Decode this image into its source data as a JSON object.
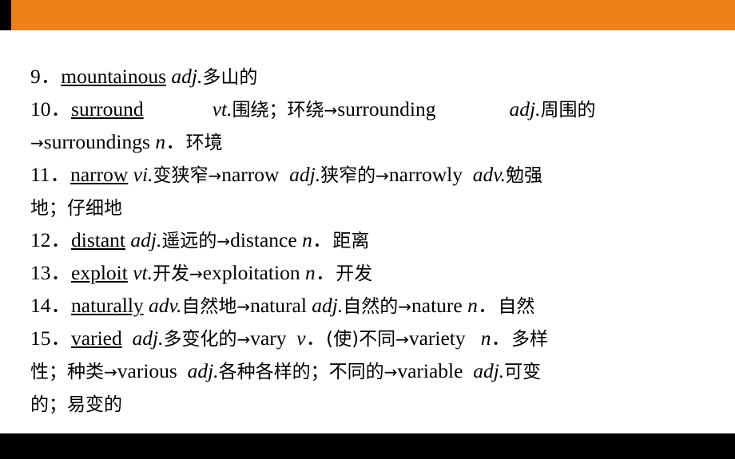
{
  "slide": {
    "top_bar_color": "#ee8018",
    "accent_black": "#000000",
    "background": "#ffffff",
    "arrow_glyph": "→",
    "entries": [
      {
        "number": "9．",
        "headword": "mountainous",
        "pos": "adj.",
        "meaning": "多山的",
        "full_text": "9．mountainous adj.多山的"
      },
      {
        "number": "10．",
        "headword": "surround",
        "pos": "vt.",
        "meaning": "围绕；环绕",
        "derivations": "→surrounding adj.周围的→surroundings n．环境",
        "full_text": "10．surround vt.围绕；环绕→surrounding adj.周围的→surroundings n．环境"
      },
      {
        "number": "11．",
        "headword": "narrow",
        "pos": "vi.",
        "meaning": "变狭窄",
        "derivations": "→narrow adj.狭窄的→narrowly adv.勉强地；仔细地",
        "full_text": "11．narrow vi.变狭窄→narrow adj.狭窄的→narrowly adv.勉强地；仔细地"
      },
      {
        "number": "12．",
        "headword": "distant",
        "pos": "adj.",
        "meaning": "遥远的",
        "derivations": "→distance n．距离",
        "full_text": "12．distant adj.遥远的→distance n．距离"
      },
      {
        "number": "13．",
        "headword": "exploit",
        "pos": "vt.",
        "meaning": "开发",
        "derivations": "→exploitation n．开发",
        "full_text": "13．exploit vt.开发→exploitation n．开发"
      },
      {
        "number": "14．",
        "headword": "naturally",
        "pos": "adv.",
        "meaning": "自然地",
        "derivations": "→natural adj.自然的→nature n．自然",
        "full_text": "14．naturally adv.自然地→natural adj.自然的→nature n．自然"
      },
      {
        "number": "15．",
        "headword": "varied",
        "pos": "adj.",
        "meaning": "多变化的",
        "derivations": "→vary v．(使)不同→variety n．多样性；种类→various adj.各种各样的；不同的→variable adj.可变的；易变的",
        "full_text": "15．varied adj.多变化的→vary v．(使)不同→variety n．多样性；种类→various adj.各种各样的；不同的→variable adj.可变的；易变的"
      }
    ],
    "lines": [
      {
        "id": "line-9",
        "segments": [
          {
            "type": "num",
            "text": "9．"
          },
          {
            "type": "hw",
            "text": "mountainous"
          },
          {
            "type": "sp",
            "text": " "
          },
          {
            "type": "pos",
            "text": "adj."
          },
          {
            "type": "cn",
            "text": "多山的"
          }
        ]
      },
      {
        "id": "line-10a",
        "segments": [
          {
            "type": "num",
            "text": "10．"
          },
          {
            "type": "hw",
            "text": "surround"
          },
          {
            "type": "gap-wide",
            "text": ""
          },
          {
            "type": "pos",
            "text": "vt."
          },
          {
            "type": "cn",
            "text": "围绕；环绕"
          },
          {
            "type": "arrow",
            "text": "→"
          },
          {
            "type": "plain",
            "text": "surrounding"
          },
          {
            "type": "gap-wide2",
            "text": ""
          },
          {
            "type": "pos",
            "text": "adj."
          },
          {
            "type": "cn",
            "text": "周围的"
          }
        ]
      },
      {
        "id": "line-10b",
        "segments": [
          {
            "type": "arrow",
            "text": "→"
          },
          {
            "type": "plain",
            "text": "surroundings "
          },
          {
            "type": "pos",
            "text": "n"
          },
          {
            "type": "plain",
            "text": "．"
          },
          {
            "type": "cn",
            "text": "环境"
          }
        ]
      },
      {
        "id": "line-11a",
        "segments": [
          {
            "type": "num",
            "text": "11．"
          },
          {
            "type": "hw",
            "text": "narrow"
          },
          {
            "type": "sp",
            "text": " "
          },
          {
            "type": "pos",
            "text": "vi."
          },
          {
            "type": "cn",
            "text": "变狭窄"
          },
          {
            "type": "arrow",
            "text": "→"
          },
          {
            "type": "plain",
            "text": "narrow"
          },
          {
            "type": "sp",
            "text": "  "
          },
          {
            "type": "pos",
            "text": "adj."
          },
          {
            "type": "cn",
            "text": "狭窄的"
          },
          {
            "type": "arrow",
            "text": "→"
          },
          {
            "type": "plain",
            "text": "narrowly"
          },
          {
            "type": "sp",
            "text": "  "
          },
          {
            "type": "pos",
            "text": "adv."
          },
          {
            "type": "cn",
            "text": "勉强"
          }
        ]
      },
      {
        "id": "line-11b",
        "segments": [
          {
            "type": "cn",
            "text": "地；仔细地"
          }
        ]
      },
      {
        "id": "line-12",
        "segments": [
          {
            "type": "num",
            "text": "12．"
          },
          {
            "type": "hw",
            "text": "distant"
          },
          {
            "type": "sp",
            "text": " "
          },
          {
            "type": "pos",
            "text": "adj."
          },
          {
            "type": "cn",
            "text": "遥远的"
          },
          {
            "type": "arrow",
            "text": "→"
          },
          {
            "type": "plain",
            "text": "distance "
          },
          {
            "type": "pos",
            "text": "n"
          },
          {
            "type": "plain",
            "text": "．"
          },
          {
            "type": "cn",
            "text": "距离"
          }
        ]
      },
      {
        "id": "line-13",
        "segments": [
          {
            "type": "num",
            "text": "13．"
          },
          {
            "type": "hw",
            "text": "exploit"
          },
          {
            "type": "sp",
            "text": " "
          },
          {
            "type": "pos",
            "text": "vt."
          },
          {
            "type": "cn",
            "text": "开发"
          },
          {
            "type": "arrow",
            "text": "→"
          },
          {
            "type": "plain",
            "text": "exploitation "
          },
          {
            "type": "pos",
            "text": "n"
          },
          {
            "type": "plain",
            "text": "．"
          },
          {
            "type": "cn",
            "text": "开发"
          }
        ]
      },
      {
        "id": "line-14",
        "segments": [
          {
            "type": "num",
            "text": "14．"
          },
          {
            "type": "hw",
            "text": "naturally"
          },
          {
            "type": "sp",
            "text": " "
          },
          {
            "type": "pos",
            "text": "adv."
          },
          {
            "type": "cn",
            "text": "自然地"
          },
          {
            "type": "arrow",
            "text": "→"
          },
          {
            "type": "plain",
            "text": "natural "
          },
          {
            "type": "pos",
            "text": "adj."
          },
          {
            "type": "cn",
            "text": "自然的"
          },
          {
            "type": "arrow",
            "text": "→"
          },
          {
            "type": "plain",
            "text": "nature "
          },
          {
            "type": "pos",
            "text": "n"
          },
          {
            "type": "plain",
            "text": "．"
          },
          {
            "type": "cn",
            "text": "自然"
          }
        ]
      },
      {
        "id": "line-15a",
        "segments": [
          {
            "type": "num",
            "text": "15．"
          },
          {
            "type": "hw",
            "text": "varied"
          },
          {
            "type": "sp",
            "text": "  "
          },
          {
            "type": "pos",
            "text": "adj."
          },
          {
            "type": "cn",
            "text": "多变化的"
          },
          {
            "type": "arrow",
            "text": "→"
          },
          {
            "type": "plain",
            "text": "vary"
          },
          {
            "type": "sp",
            "text": "  "
          },
          {
            "type": "pos",
            "text": "v"
          },
          {
            "type": "plain",
            "text": "．"
          },
          {
            "type": "cn",
            "text": "(使)不同"
          },
          {
            "type": "arrow",
            "text": "→"
          },
          {
            "type": "plain",
            "text": "variety"
          },
          {
            "type": "sp",
            "text": "   "
          },
          {
            "type": "pos",
            "text": "n"
          },
          {
            "type": "plain",
            "text": "．"
          },
          {
            "type": "cn",
            "text": "多样"
          }
        ]
      },
      {
        "id": "line-15b",
        "segments": [
          {
            "type": "cn",
            "text": "性；种类"
          },
          {
            "type": "arrow",
            "text": "→"
          },
          {
            "type": "plain",
            "text": "various"
          },
          {
            "type": "sp",
            "text": "  "
          },
          {
            "type": "pos",
            "text": "adj."
          },
          {
            "type": "cn",
            "text": "各种各样的；不同的"
          },
          {
            "type": "arrow",
            "text": "→"
          },
          {
            "type": "plain",
            "text": "variable"
          },
          {
            "type": "sp",
            "text": "  "
          },
          {
            "type": "pos",
            "text": "adj."
          },
          {
            "type": "cn",
            "text": "可变"
          }
        ]
      },
      {
        "id": "line-15c",
        "segments": [
          {
            "type": "cn",
            "text": "的；易变的"
          }
        ]
      }
    ]
  }
}
